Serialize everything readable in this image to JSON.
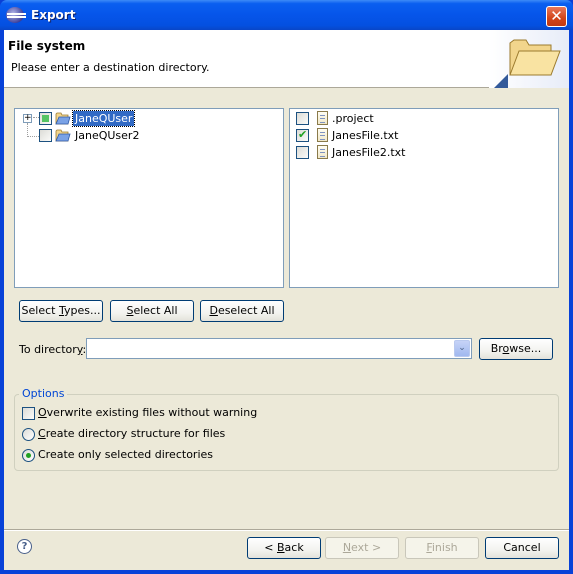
{
  "window": {
    "title": "Export",
    "close_glyph": "✕"
  },
  "banner": {
    "title": "File system",
    "message": "Please enter a destination directory.",
    "icon": "open-folder-icon"
  },
  "tree": {
    "items": [
      {
        "label": "JaneQUser",
        "expandable": true,
        "expander_glyph": "+",
        "check_state": "partial",
        "selected": true
      },
      {
        "label": "JaneQUser2",
        "expandable": false,
        "check_state": "unchecked",
        "selected": false
      }
    ]
  },
  "files": {
    "items": [
      {
        "label": ".project",
        "checked": false
      },
      {
        "label": "JanesFile.txt",
        "checked": true
      },
      {
        "label": "JanesFile2.txt",
        "checked": false
      }
    ]
  },
  "selection_buttons": {
    "select_types": {
      "pre": "Select ",
      "mn": "T",
      "post": "ypes..."
    },
    "select_all": {
      "pre": "",
      "mn": "S",
      "post": "elect All"
    },
    "deselect_all": {
      "pre": "",
      "mn": "D",
      "post": "eselect All"
    }
  },
  "destination": {
    "label_pre": "To director",
    "label_mn": "y",
    "label_post": ":",
    "value": "",
    "combo_glyph": "⌄",
    "browse": {
      "pre": "Br",
      "mn": "o",
      "post": "wse..."
    }
  },
  "options": {
    "title": "Options",
    "overwrite": {
      "mn": "O",
      "post": "verwrite existing files without warning",
      "checked": false
    },
    "create_structure": {
      "mn": "C",
      "post": "reate directory structure for files",
      "selected": false
    },
    "create_selected": {
      "pre": "Create only selected directories",
      "selected": true
    }
  },
  "footer": {
    "help_glyph": "?",
    "back": {
      "pre": "< ",
      "mn": "B",
      "post": "ack",
      "enabled": true
    },
    "next": {
      "pre": "",
      "mn": "N",
      "post": "ext >",
      "enabled": false
    },
    "finish": {
      "pre": "",
      "mn": "F",
      "post": "inish",
      "enabled": false
    },
    "cancel": {
      "label": "Cancel",
      "enabled": true
    }
  }
}
